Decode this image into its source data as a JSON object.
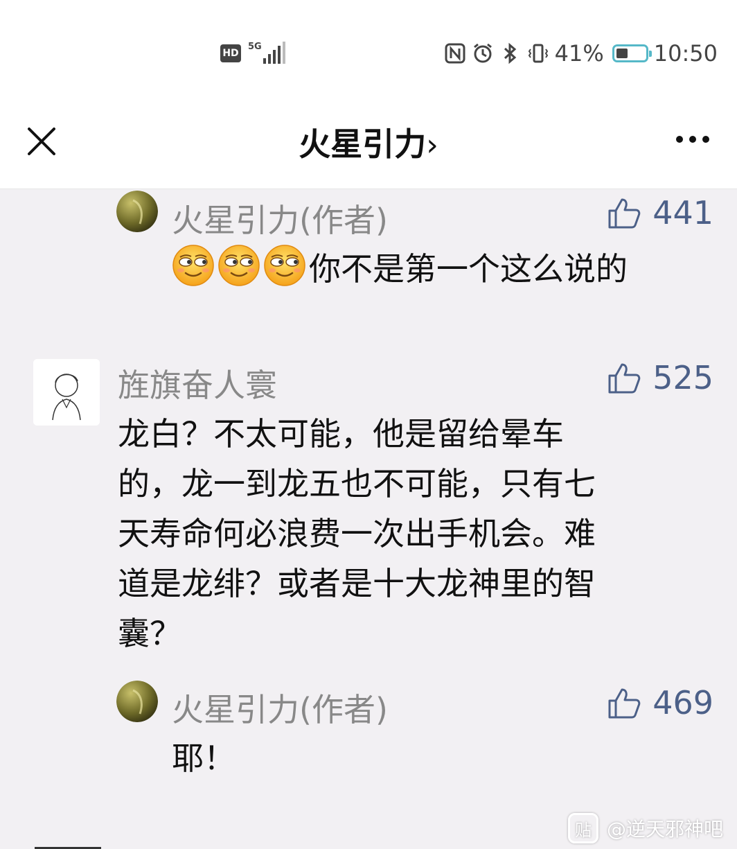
{
  "status_bar": {
    "hd_label": "HD",
    "network_label": "5G",
    "battery_percent": "41%",
    "battery_level": 0.41,
    "time": "10:50",
    "icons": [
      "nfc-icon",
      "alarm-icon",
      "bluetooth-icon",
      "vibrate-icon"
    ]
  },
  "header": {
    "title": "火星引力",
    "title_chevron": "›",
    "close_icon": "close-icon",
    "more_icon": "more-dots-icon"
  },
  "comments": [
    {
      "kind": "reply",
      "username": "火星引力(作者)",
      "likes": "441",
      "emoji_count": 3,
      "text": "你不是第一个这么说的"
    },
    {
      "kind": "comment",
      "username": "旌旗奋人寰",
      "likes": "525",
      "lines": [
        "龙白？不太可能，他是留给晕车",
        "的，龙一到龙五也不可能，只有七",
        "天寿命何必浪费一次出手机会。难",
        "道是龙绯？或者是十大龙神里的智",
        "囊？"
      ]
    },
    {
      "kind": "reply",
      "username": "火星引力(作者)",
      "likes": "469",
      "text": "耶！"
    }
  ],
  "watermark": {
    "logo_text": "贴",
    "text": "@逆天邪神吧"
  },
  "colors": {
    "background": "#f2f0f3",
    "like_color": "#4c6088",
    "username_color": "#888888",
    "battery_accent": "#55b8c8"
  }
}
